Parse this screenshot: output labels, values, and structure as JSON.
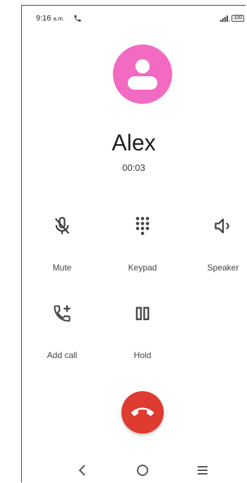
{
  "status_bar": {
    "time": "9:16",
    "ampm": "a.m.",
    "battery": "100"
  },
  "call": {
    "caller_name": "Alex",
    "duration": "00:03"
  },
  "controls": {
    "mute": "Mute",
    "keypad": "Keypad",
    "speaker": "Speaker",
    "add_call": "Add call",
    "hold": "Hold"
  },
  "colors": {
    "avatar": "#f36ac2",
    "end_call": "#de3b31"
  },
  "icons": {
    "status": [
      "phone-icon",
      "signal-icon",
      "battery-icon"
    ],
    "controls": [
      "mic-off-icon",
      "dialpad-icon",
      "speaker-icon",
      "add-call-icon",
      "pause-icon"
    ],
    "navigation": [
      "back-icon",
      "home-icon",
      "menu-icon"
    ]
  }
}
